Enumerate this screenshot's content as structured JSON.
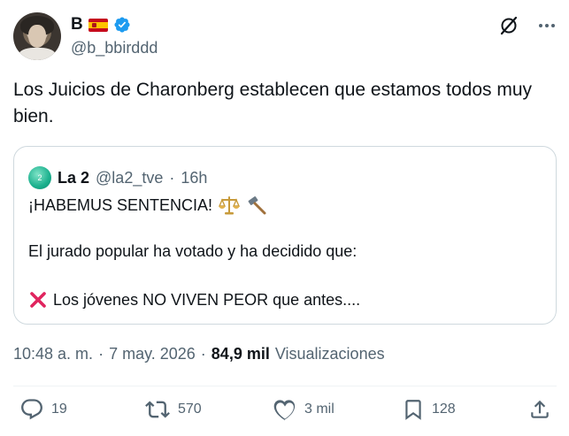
{
  "author": {
    "name": "B",
    "handle": "@b_bbirddd"
  },
  "tweet": {
    "text": "Los Juicios de Charonberg establecen que estamos todos muy bien."
  },
  "quote": {
    "name": "La 2",
    "handle": "@la2_tve",
    "separator": "·",
    "time": "16h",
    "avatar_label": "2",
    "line1": "¡HABEMUS SENTENCIA!",
    "line2": "El jurado popular ha votado y ha decidido que:",
    "line3": "Los jóvenes NO VIVEN PEOR que antes...."
  },
  "meta": {
    "time": "10:48 a. m.",
    "separator": "·",
    "date": "7 may. 2026",
    "separator2": "·",
    "views_count": "84,9 mil",
    "views_label": "Visualizaciones"
  },
  "actions": {
    "replies": "19",
    "reposts": "570",
    "likes": "3 mil",
    "bookmarks": "128"
  },
  "colors": {
    "text": "#0f1419",
    "secondary": "#536471",
    "verified": "#1d9bf0",
    "border": "#cfd9de",
    "cross": "#e0245e"
  },
  "icons": [
    "grok-icon",
    "more-icon",
    "verified-badge-icon",
    "scales-icon",
    "hammer-icon",
    "cross-mark-icon",
    "reply-icon",
    "repost-icon",
    "like-icon",
    "bookmark-icon",
    "share-icon"
  ]
}
